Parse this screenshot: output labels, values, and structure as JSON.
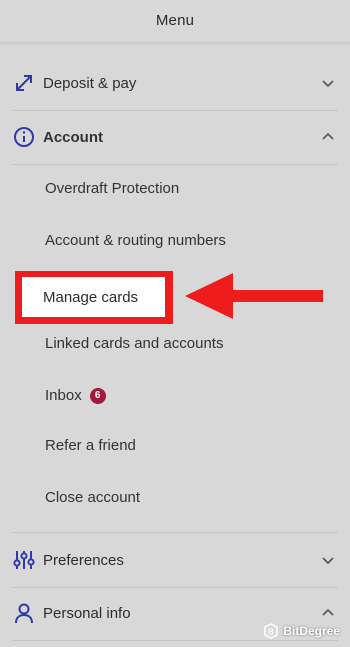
{
  "header": {
    "title": "Menu"
  },
  "sections": {
    "deposit": {
      "label": "Deposit & pay",
      "icon": "transfer-arrows-icon",
      "state": "collapsed"
    },
    "account": {
      "label": "Account",
      "icon": "info-circle-icon",
      "state": "expanded"
    },
    "preferences": {
      "label": "Preferences",
      "icon": "sliders-icon",
      "state": "collapsed"
    },
    "personal": {
      "label": "Personal info",
      "icon": "person-icon",
      "state": "expanded"
    }
  },
  "account_items": {
    "overdraft": "Overdraft Protection",
    "routing": "Account & routing numbers",
    "manage_cards": "Manage cards",
    "linked": "Linked cards and accounts",
    "inbox": "Inbox",
    "inbox_count": "6",
    "refer": "Refer a friend",
    "close": "Close account"
  },
  "watermark": {
    "text": "BitDegree"
  },
  "colors": {
    "accent_blue": "#2f3aa8",
    "highlight_red": "#ee1c1c",
    "badge": "#a3183b",
    "background": "#d8d8d8"
  }
}
